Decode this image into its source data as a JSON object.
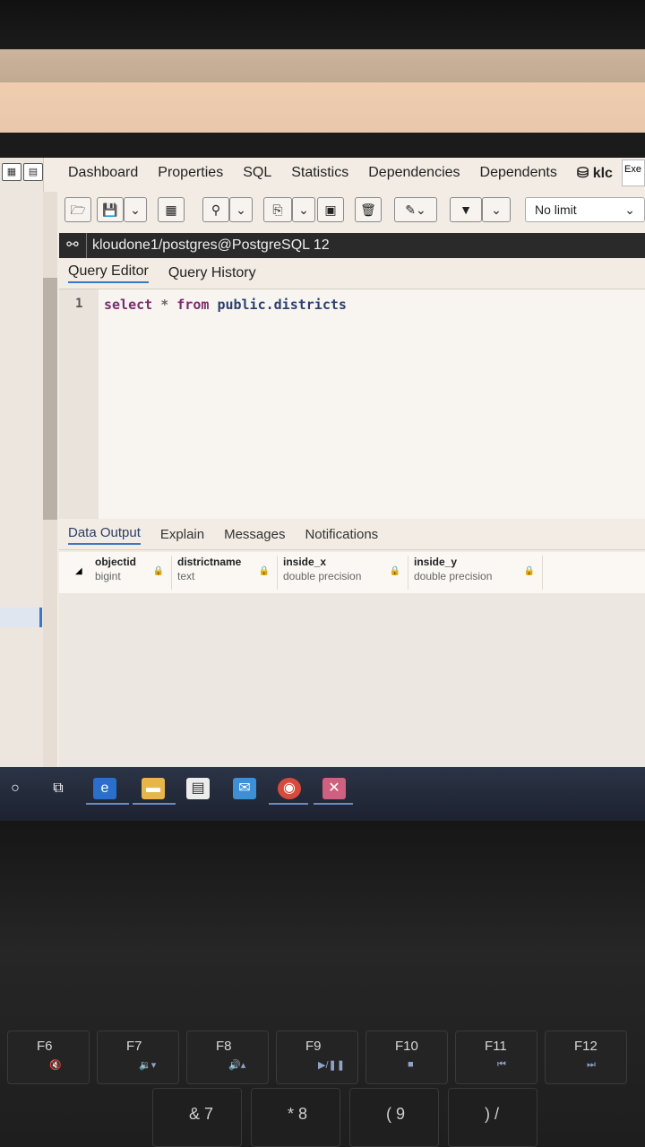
{
  "tabs": {
    "items": [
      "Dashboard",
      "Properties",
      "SQL",
      "Statistics",
      "Dependencies",
      "Dependents",
      "klc"
    ],
    "exec_label": "Exe"
  },
  "toolbar": {
    "limit": "No limit",
    "icons": [
      "open-file-icon",
      "save-icon",
      "chevron-down-icon",
      "table-icon",
      "search-icon",
      "chevron-down-icon",
      "copy-icon",
      "chevron-down-icon",
      "paste-icon",
      "delete-icon",
      "edit-icon",
      "chevron-down-icon",
      "filter-icon",
      "chevron-down-icon"
    ]
  },
  "connection": {
    "label": "kloudone1/postgres@PostgreSQL 12"
  },
  "editor_tabs": [
    "Query Editor",
    "Query History"
  ],
  "editor": {
    "line_number": "1",
    "tokens": {
      "select": "select",
      "star": "*",
      "from": "from",
      "table": "public.districts"
    }
  },
  "output_tabs": [
    "Data Output",
    "Explain",
    "Messages",
    "Notifications"
  ],
  "columns": [
    {
      "name": "objectid",
      "type": "bigint"
    },
    {
      "name": "districtname",
      "type": "text"
    },
    {
      "name": "inside_x",
      "type": "double precision"
    },
    {
      "name": "inside_y",
      "type": "double precision"
    }
  ],
  "keyboard": {
    "fkeys": [
      "F6",
      "F7",
      "F8",
      "F9",
      "F10",
      "F11",
      "F12"
    ],
    "digits": [
      "&  7",
      "*  8",
      "(  9",
      ")  /"
    ]
  }
}
